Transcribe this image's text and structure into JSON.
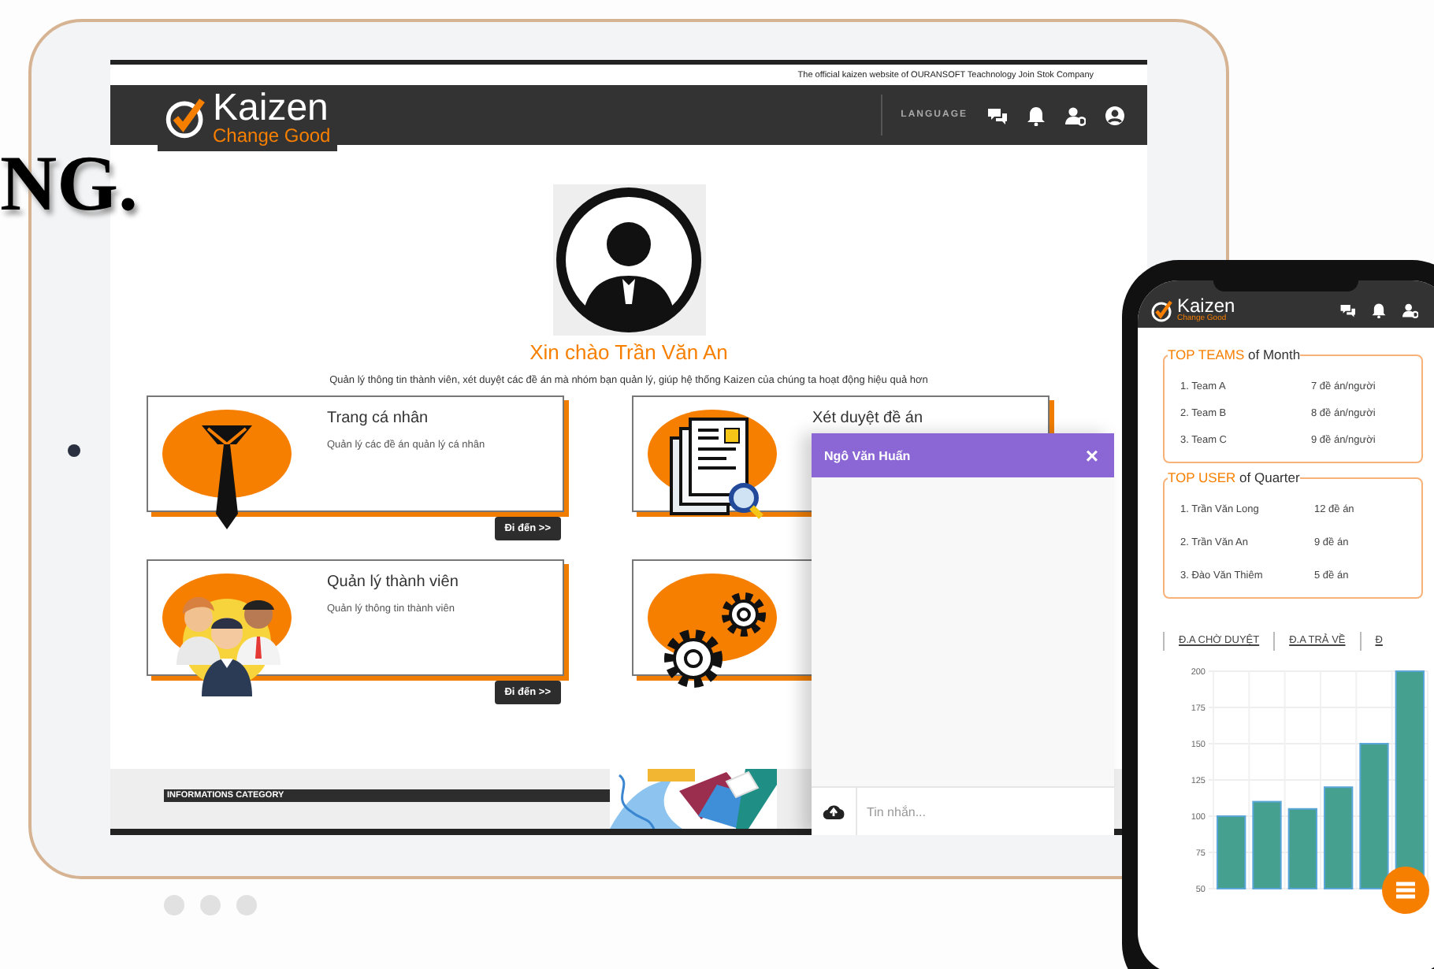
{
  "headline": "NG.",
  "tablet": {
    "tagline": "The official kaizen website of OURANSOFT Teachnology Join Stok Company",
    "logo": {
      "name": "Kaizen",
      "slogan": "Change Good"
    },
    "language_label": "LANGUAGE",
    "greeting": "Xin chào Trần Văn An",
    "intro": "Quản lý thông tin thành viên, xét duyệt các đề án mà nhóm bạn quản lý, giúp hệ thống Kaizen của chúng ta hoạt động hiệu quả hơn",
    "cards": [
      {
        "kind": "tie",
        "title": "Trang cá nhân",
        "description": "Quản lý các đề án quản lý cá nhân",
        "button": "Đi đến >>"
      },
      {
        "kind": "document",
        "title": "Xét duyệt đề án"
      },
      {
        "kind": "team",
        "title": "Quản lý thành viên",
        "description": "Quản lý thông tin thành viên",
        "button": "Đi đến >>"
      },
      {
        "kind": "gears"
      }
    ],
    "chat": {
      "contact": "Ngô Văn Huấn",
      "close": "×",
      "placeholder": "Tin nhắn..."
    },
    "footer": {
      "category_title": "INFORMATIONS CATEGORY"
    }
  },
  "carousel_dots": [
    {
      "selected": false
    },
    {
      "selected": false
    },
    {
      "selected": false
    }
  ],
  "phone": {
    "logo": {
      "name": "Kaizen",
      "slogan": "Change Good"
    },
    "boxes": [
      {
        "highlight": "TOP TEAMS",
        "title": "of Month",
        "rows": [
          {
            "name": "1. Team A",
            "value": "7 đề án/người"
          },
          {
            "name": "2. Team B",
            "value": "8 đề án/người"
          },
          {
            "name": "3. Team C",
            "value": "9 đề án/người"
          }
        ]
      },
      {
        "highlight": "TOP USER",
        "title": "of Quarter",
        "rows": [
          {
            "name": "1. Trần Văn Long",
            "value": "12 đề án"
          },
          {
            "name": "2. Trần Văn An",
            "value": "9 đề án"
          },
          {
            "name": "3. Đào Văn Thiêm",
            "value": "5 đề án"
          }
        ]
      }
    ],
    "tabs": [
      {
        "label": "Đ.A CHỜ DUYỆT"
      },
      {
        "label": "Đ.A TRẢ VỀ"
      },
      {
        "label": "Đ"
      }
    ],
    "chart_data": {
      "type": "bar",
      "grid": true,
      "values": [
        100,
        110,
        105,
        120,
        150,
        200
      ],
      "ylim": [
        50,
        200
      ],
      "yticks": [
        50,
        75,
        100,
        125,
        150,
        175,
        200
      ]
    }
  }
}
